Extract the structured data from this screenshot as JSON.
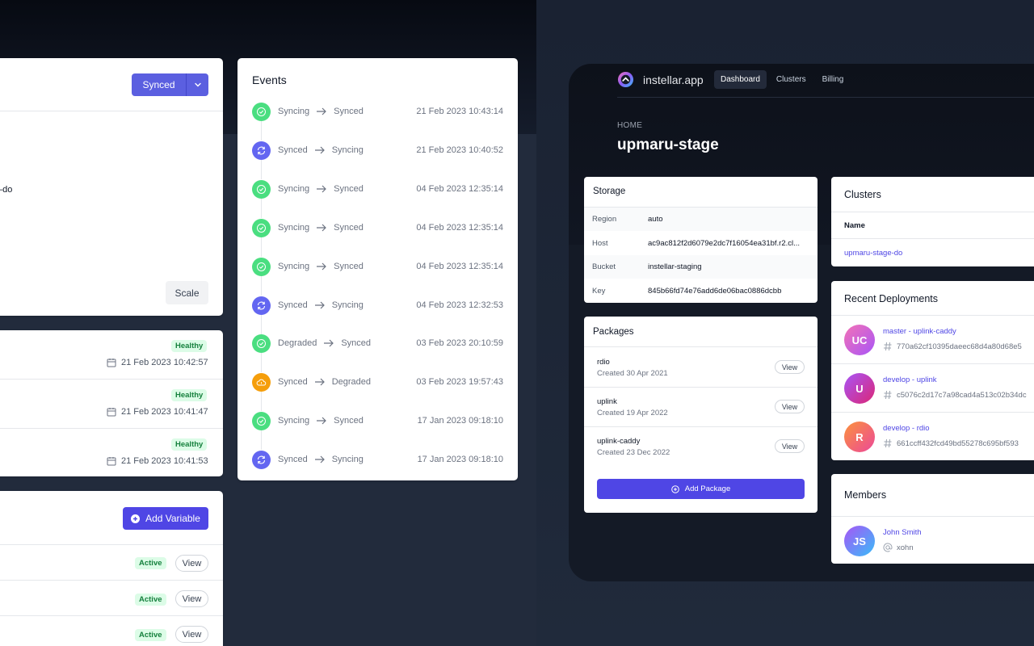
{
  "colors": {
    "primary": "#4f46e5",
    "synced_green": "#4ade80",
    "syncing_purple": "#6366f1",
    "degraded_orange": "#f59e0b",
    "healthy_bg": "#dcfce7",
    "healthy_text": "#15803d"
  },
  "left": {
    "top_card": {
      "status_button": "Synced",
      "partial_text": "–do",
      "scale_button": "Scale"
    },
    "health_list": [
      {
        "badge": "Healthy",
        "date": "21 Feb 2023 10:42:57"
      },
      {
        "badge": "Healthy",
        "date": "21 Feb 2023 10:41:47"
      },
      {
        "badge": "Healthy",
        "date": "21 Feb 2023 10:41:53"
      }
    ],
    "variables": {
      "add_button": "Add Variable",
      "rows": [
        {
          "badge": "Active",
          "action": "View"
        },
        {
          "badge": "Active",
          "action": "View"
        },
        {
          "badge": "Active",
          "action": "View"
        }
      ]
    }
  },
  "events": {
    "title": "Events",
    "items": [
      {
        "from": "Syncing",
        "to": "Synced",
        "time": "21 Feb 2023 10:43:14",
        "icon": "check-icon"
      },
      {
        "from": "Synced",
        "to": "Syncing",
        "time": "21 Feb 2023 10:40:52",
        "icon": "sync-icon"
      },
      {
        "from": "Syncing",
        "to": "Synced",
        "time": "04 Feb 2023 12:35:14",
        "icon": "check-icon"
      },
      {
        "from": "Syncing",
        "to": "Synced",
        "time": "04 Feb 2023 12:35:14",
        "icon": "check-icon"
      },
      {
        "from": "Syncing",
        "to": "Synced",
        "time": "04 Feb 2023 12:35:14",
        "icon": "check-icon"
      },
      {
        "from": "Synced",
        "to": "Syncing",
        "time": "04 Feb 2023 12:32:53",
        "icon": "sync-icon"
      },
      {
        "from": "Degraded",
        "to": "Synced",
        "time": "03 Feb 2023 20:10:59",
        "icon": "check-icon"
      },
      {
        "from": "Synced",
        "to": "Degraded",
        "time": "03 Feb 2023 19:57:43",
        "icon": "cloud-warning-icon"
      },
      {
        "from": "Syncing",
        "to": "Synced",
        "time": "17 Jan 2023 09:18:10",
        "icon": "check-icon"
      },
      {
        "from": "Synced",
        "to": "Syncing",
        "time": "17 Jan 2023 09:18:10",
        "icon": "sync-icon"
      }
    ]
  },
  "app": {
    "brand": "instellar.app",
    "nav": [
      {
        "label": "Dashboard",
        "active": true
      },
      {
        "label": "Clusters",
        "active": false
      },
      {
        "label": "Billing",
        "active": false
      }
    ],
    "breadcrumb": "HOME",
    "title": "upmaru-stage",
    "storage": {
      "title": "Storage",
      "rows": [
        {
          "key": "Region",
          "value": "auto"
        },
        {
          "key": "Host",
          "value": "ac9ac812f2d6079e2dc7f16054ea31bf.r2.cl..."
        },
        {
          "key": "Bucket",
          "value": "instellar-staging"
        },
        {
          "key": "Key",
          "value": "845b66fd74e76add6de06bac0886dcbb"
        }
      ]
    },
    "packages": {
      "title": "Packages",
      "items": [
        {
          "name": "rdio",
          "created": "Created 30 Apr 2021",
          "action": "View"
        },
        {
          "name": "uplink",
          "created": "Created 19 Apr 2022",
          "action": "View"
        },
        {
          "name": "uplink-caddy",
          "created": "Created 23 Dec 2022",
          "action": "View"
        }
      ],
      "add_button": "Add Package"
    },
    "clusters": {
      "title": "Clusters",
      "column": "Name",
      "items": [
        "upmaru-stage-do"
      ]
    },
    "deployments": {
      "title": "Recent Deployments",
      "items": [
        {
          "initials": "UC",
          "name": "master - uplink-caddy",
          "hash": "770a62cf10395daeec68d4a80d68e5"
        },
        {
          "initials": "U",
          "name": "develop - uplink",
          "hash": "c5076c2d17c7a98cad4a513c02b34dc"
        },
        {
          "initials": "R",
          "name": "develop - rdio",
          "hash": "661ccff432fcd49bd55278c695bf593"
        }
      ]
    },
    "members": {
      "title": "Members",
      "items": [
        {
          "initials": "JS",
          "name": "John Smith",
          "handle": "xohn"
        }
      ]
    }
  }
}
